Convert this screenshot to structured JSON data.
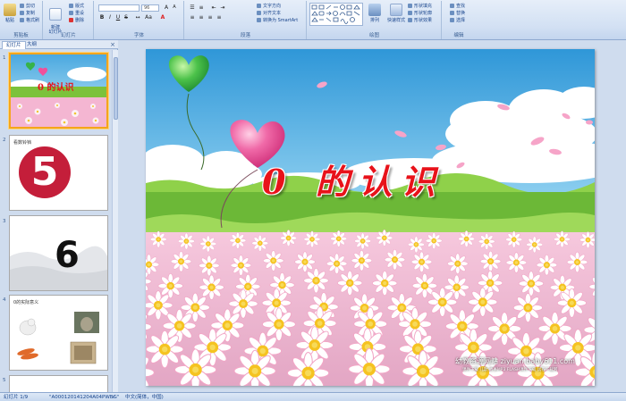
{
  "ribbon": {
    "clipboard": {
      "paste": "粘贴",
      "cut": "剪切",
      "copy": "复制",
      "format_painter": "格式刷",
      "label": "剪贴板"
    },
    "slides": {
      "new_slide": "新建\n幻灯片",
      "layout": "版式",
      "reset": "重设",
      "delete": "删除",
      "label": "幻灯片"
    },
    "font": {
      "font_name": "",
      "font_size": "96",
      "label": "字体"
    },
    "paragraph": {
      "text_direction": "文字方向",
      "align_text": "对齐文本",
      "smartart": "转换为 SmartArt",
      "label": "段落"
    },
    "drawing": {
      "arrange": "排列",
      "quick_styles": "快速样式",
      "shape_fill": "形状填充",
      "shape_outline": "形状轮廓",
      "shape_effects": "形状效果",
      "label": "绘图"
    },
    "editing": {
      "find": "查找",
      "replace": "替换",
      "select": "选择",
      "label": "编辑"
    }
  },
  "pane": {
    "tab_slides": "幻灯片",
    "tab_outline": "大纲",
    "close": "×",
    "thumbs": [
      {
        "num": "1",
        "title": "0 的认识"
      },
      {
        "num": "2",
        "caption": "看数铃铛",
        "big": "5"
      },
      {
        "num": "3",
        "big": "6"
      },
      {
        "num": "4",
        "caption": "0的实际意义"
      },
      {
        "num": "5"
      }
    ]
  },
  "slide": {
    "title": "0 的认识",
    "watermark_main": "幼教资源网站  ziyuan.baby611.com",
    "watermark_sub": "课件下载  儿歌  故事MP3  FLASH课件下载  试卷下载网"
  },
  "colors": {
    "title": "#e8121a",
    "sky_top": "#4aa8e0",
    "grass": "#7cc23b",
    "balloon_pink": "#f0509a",
    "balloon_green": "#36b34a",
    "selected_border": "#f4a51c"
  },
  "status": {
    "slide_info": "幻灯片 1/9",
    "theme": "\"A000120141204A04PWBG\"",
    "language": "中文(简体，中国)"
  }
}
